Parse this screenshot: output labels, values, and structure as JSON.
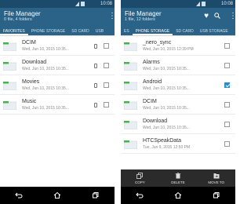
{
  "status_time": "10:08",
  "left": {
    "title": "File Manager",
    "subtitle": "0 file, 4 folders",
    "tabs": [
      "FAVORITES",
      "PHONE STORAGE",
      "SD CARD",
      "USB"
    ],
    "rows": [
      {
        "name": "DCIM",
        "date": "Wed, Jun 10, 2015 10:35..."
      },
      {
        "name": "Download",
        "date": "Wed, Jun 10, 2015 10:35..."
      },
      {
        "name": "Movies",
        "date": "Wed, Jun 10, 2015 10:35..."
      },
      {
        "name": "Music",
        "date": "Wed, Jun 10, 2015 10:35..."
      }
    ]
  },
  "right": {
    "title": "File Manager",
    "subtitle": "1 file, 12 folders",
    "tabs": [
      "ES",
      "PHONE STORAGE",
      "SD CARD",
      "USB STORAGE"
    ],
    "rows": [
      {
        "name": "_nero_sync",
        "date": "Wed, Jun 10, 2015 12:39 PM",
        "checked": false
      },
      {
        "name": "Alarms",
        "date": "Wed, Jun 10, 2015 10:35...",
        "checked": false
      },
      {
        "name": "Android",
        "date": "Wed, Jun 10, 2015 10:35...",
        "checked": true
      },
      {
        "name": "DCIM",
        "date": "Wed, Jun 10, 2015 10:35...",
        "checked": false
      },
      {
        "name": "Download",
        "date": "Wed, Jun 10, 2015 10:35...",
        "checked": false
      },
      {
        "name": "HTCSpeakData",
        "date": "Tue, Jun 9, 2015 12:50 PM",
        "checked": false
      }
    ],
    "actions": [
      "COPY",
      "DELETE",
      "MOVE TO"
    ]
  },
  "colors": {
    "appbar": "#2a6387",
    "statusbar": "#1c4a6b",
    "folder": "#4caf50",
    "checkbox": "#2a8cd1"
  }
}
